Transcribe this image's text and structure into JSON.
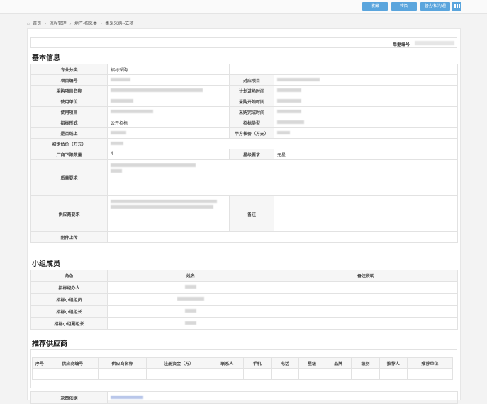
{
  "toolbar": {
    "btn1": "收藏",
    "btn2": "传阅",
    "btn3": "督办和沟通"
  },
  "breadcrumb": {
    "home": "首页",
    "items": [
      "流程管理",
      "地产-招采类",
      "集采采购--立项"
    ]
  },
  "header": {
    "doc_no_label": "单据编号"
  },
  "basic": {
    "title": "基本信息",
    "major_label": "专业分类",
    "major_value": "招标采购",
    "proj_no_label": "项目编号",
    "counter_proj_label": "对应项目",
    "purchase_name_label": "采购项目名称",
    "plan_start_label": "计划进场时间",
    "use_unit_label": "使用单位",
    "purchase_start_label": "采购开始时间",
    "use_proj_label": "使用项目",
    "purchase_end_label": "采购完成时间",
    "bid_form_label": "招标形式",
    "bid_form_value": "公开招标",
    "bid_type_label": "招标类型",
    "online_label": "是否线上",
    "party_a_price_label": "甲方核价（万元）",
    "init_price_label": "初步估价（万元）",
    "vendor_count_label": "厂商下限数量",
    "vendor_count_value": "4",
    "star_label": "星级要求",
    "star_value": "无星",
    "quality_label": "质量要求",
    "supplier_req_label": "供应商要求",
    "remark_label": "备注",
    "attach_label": "附件上传"
  },
  "team": {
    "title": "小组成员",
    "headers": [
      "角色",
      "姓名",
      "备注说明"
    ],
    "roles": [
      "招标经办人",
      "招标小组组员",
      "招标小组组长",
      "招标小组副组长"
    ]
  },
  "suppliers": {
    "title": "推荐供应商",
    "headers": [
      "序号",
      "供应商编号",
      "供应商名称",
      "注册资金（万）",
      "联系人",
      "手机",
      "电话",
      "星级",
      "品牌",
      "级别",
      "推荐人",
      "推荐单位"
    ],
    "basis_label": "决策依据"
  }
}
